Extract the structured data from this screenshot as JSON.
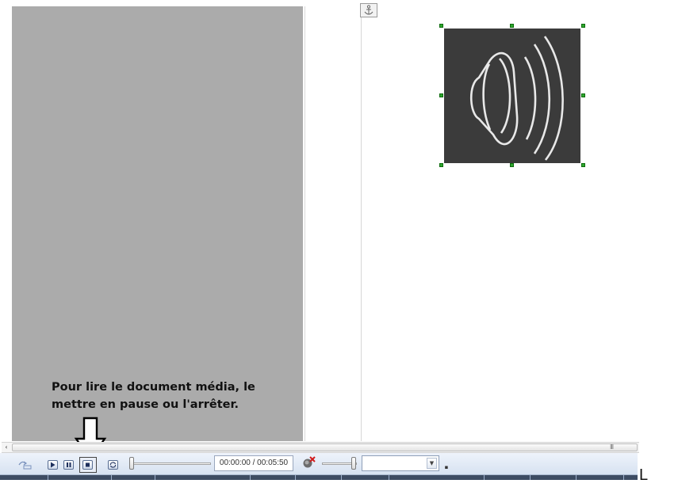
{
  "document": {
    "caption_line1": "Pour lire le document média, le",
    "caption_line2": "mettre en pause ou l'arrêter.",
    "media_icon": "speaker-sound-icon",
    "anchor_icon": "anchor-icon"
  },
  "media_toolbar": {
    "insert_media_icon": "insert-media-icon",
    "play_icon": "play-icon",
    "pause_icon": "pause-icon",
    "stop_icon": "stop-icon",
    "repeat_icon": "repeat-icon",
    "time_display": "00:00:00 / 00:05:50",
    "mute_icon": "mute-speaker-icon",
    "zoom_value": ""
  },
  "scrollbar": {
    "left_arrow": "‹",
    "grip": "III"
  },
  "corner_text": "L",
  "colors": {
    "canvas_gray": "#ababab",
    "media_background": "#3b3b3b",
    "selection_handle": "#2ea82e",
    "toolbar_top": "#eef3fb",
    "toolbar_bottom": "#d7e2f1"
  }
}
